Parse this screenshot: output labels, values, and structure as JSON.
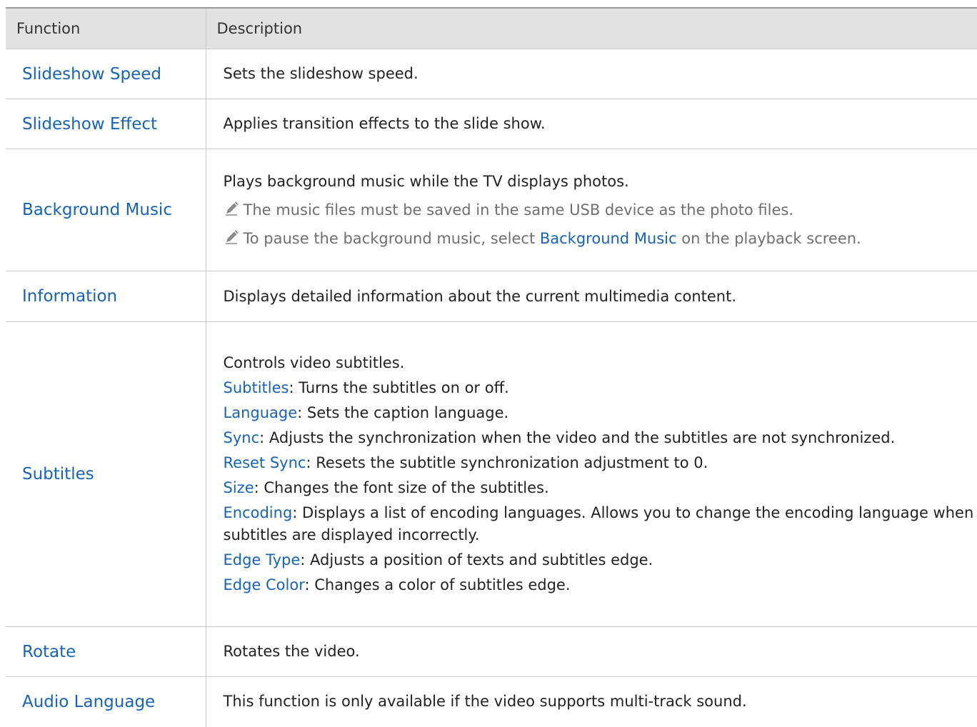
{
  "header": {
    "function": "Function",
    "description": "Description"
  },
  "rows": [
    {
      "function": "Slideshow Speed",
      "description": "Sets the slideshow speed."
    },
    {
      "function": "Slideshow Effect",
      "description": "Applies transition effects to the slide show."
    },
    {
      "function": "Background Music",
      "description": "Plays background music while the TV displays photos.",
      "notes": [
        {
          "text": "The music files must be saved in the same USB device as the photo files."
        },
        {
          "pre": "To pause the background music, select ",
          "keyword": "Background Music",
          "post": " on the playback screen."
        }
      ]
    },
    {
      "function": "Information",
      "description": "Displays detailed information about the current multimedia content."
    },
    {
      "function": "Subtitles",
      "description": "Controls video subtitles.",
      "items": [
        {
          "keyword": "Subtitles",
          "text": ": Turns the subtitles on or off."
        },
        {
          "keyword": "Language",
          "text": ": Sets the caption language."
        },
        {
          "keyword": "Sync",
          "text": ": Adjusts the synchronization when the video and the subtitles are not synchronized."
        },
        {
          "keyword": "Reset Sync",
          "text": ": Resets the subtitle synchronization adjustment to 0."
        },
        {
          "keyword": "Size",
          "text": ": Changes the font size of the subtitles."
        },
        {
          "keyword": "Encoding",
          "text": ": Displays a list of encoding languages. Allows you to change the encoding language when subtitles are displayed incorrectly."
        },
        {
          "keyword": "Edge Type",
          "text": ": Adjusts a position of texts and subtitles edge."
        },
        {
          "keyword": "Edge Color",
          "text": ": Changes a color of subtitles edge."
        }
      ]
    },
    {
      "function": "Rotate",
      "description": "Rotates the video."
    },
    {
      "function": "Audio Language",
      "description": "This function is only available if the video supports multi-track sound."
    }
  ],
  "icons": {
    "note": "pencil-icon"
  },
  "colors": {
    "keyword": "#1863b8",
    "note_text": "#6f6f6f",
    "header_bg": "#e2e2e2",
    "border": "#c8c8c8"
  }
}
